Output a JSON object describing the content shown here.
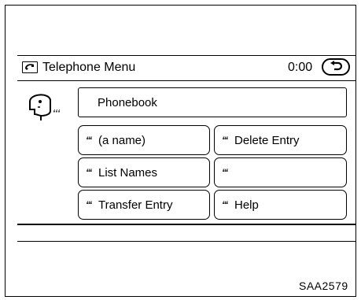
{
  "header": {
    "icon": "telephone-icon",
    "title": "Telephone Menu",
    "timer": "0:00",
    "back_icon": "back-arrow-icon"
  },
  "voice_icon": "voice-recognition-icon",
  "phonebook": {
    "label": "Phonebook"
  },
  "menu": {
    "mic_glyph": "ʻʻʻ",
    "items": [
      {
        "label": "(a name)"
      },
      {
        "label": "Delete Entry"
      },
      {
        "label": "List Names"
      },
      {
        "label": ""
      },
      {
        "label": "Transfer Entry"
      },
      {
        "label": "Help"
      }
    ]
  },
  "caption": "SAA2579"
}
